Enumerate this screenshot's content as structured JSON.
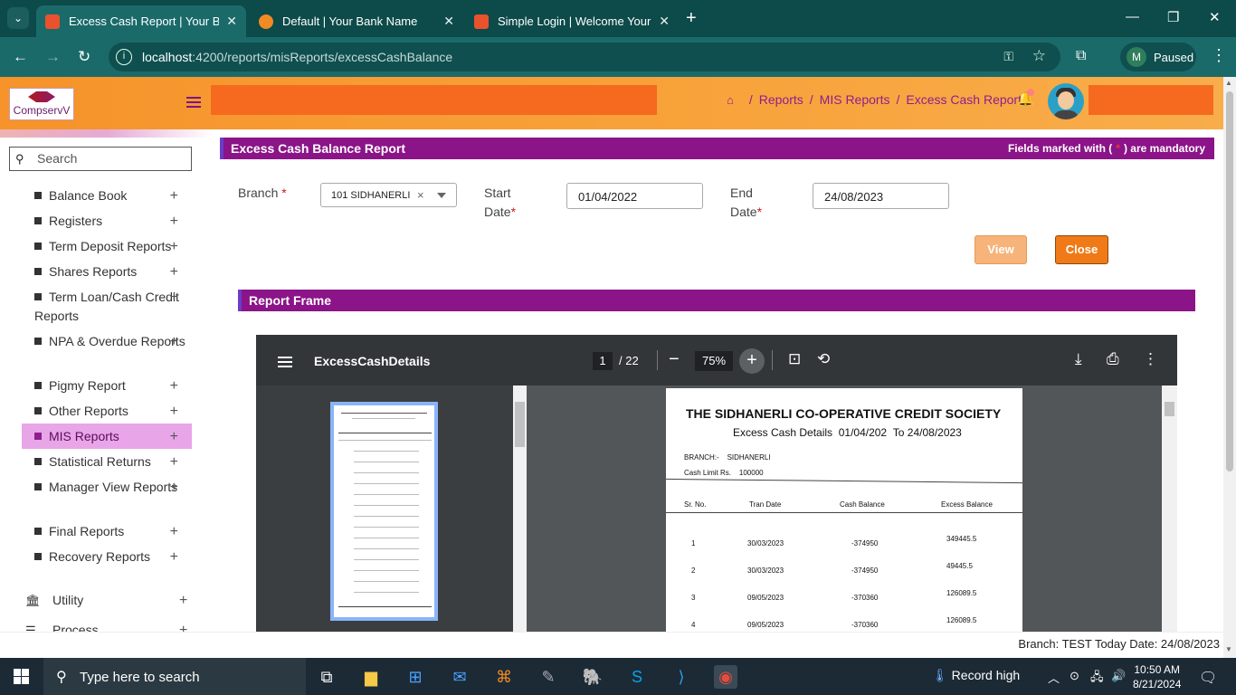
{
  "browser": {
    "tabs": [
      {
        "title": "Excess Cash Report | Your Bank",
        "active": true
      },
      {
        "title": "Default | Your Bank Name",
        "active": false
      },
      {
        "title": "Simple Login | Welcome Your B",
        "active": false
      }
    ],
    "url_host": "localhost",
    "url_path": ":4200/reports/misReports/excessCashBalance",
    "profile_initial": "M",
    "profile_status": "Paused"
  },
  "app": {
    "logo_text": "CompservV",
    "breadcrumbs": [
      "Reports",
      "MIS Reports",
      "Excess Cash Report"
    ]
  },
  "sidebar": {
    "search_placeholder": "Search",
    "items": [
      {
        "label": "Balance Book"
      },
      {
        "label": "Registers"
      },
      {
        "label": "Term Deposit Reports"
      },
      {
        "label": "Shares Reports"
      },
      {
        "label": "Term Loan/Cash Credit Reports"
      },
      {
        "label": "NPA & Overdue Reports"
      },
      {
        "label": "Pigmy Report"
      },
      {
        "label": "Other Reports"
      },
      {
        "label": "MIS Reports",
        "active": true
      },
      {
        "label": "Statistical Returns"
      },
      {
        "label": "Manager View Reports"
      },
      {
        "label": "Final Reports"
      },
      {
        "label": "Recovery Reports"
      }
    ],
    "top_items": [
      {
        "label": "Utility",
        "icon": "bank-icon"
      },
      {
        "label": "Process",
        "icon": "list-icon"
      }
    ]
  },
  "form": {
    "title": "Excess Cash Balance Report",
    "mandatory_note_prefix": "Fields marked with (",
    "mandatory_note_star": "*",
    "mandatory_note_suffix": ") are mandatory",
    "branch_label": "Branch",
    "branch_value": "101 SIDHANERLI",
    "start_label_1": "Start",
    "start_label_2": "Date",
    "start_value": "01/04/2022",
    "end_label_1": "End",
    "end_label_2": "Date",
    "end_value": "24/08/2023",
    "view_button": "View",
    "close_button": "Close",
    "report_frame_title": "Report Frame"
  },
  "pdf": {
    "doc_name": "ExcessCashDetails",
    "page": "1",
    "total_pages": "/ 22",
    "zoom": "75%",
    "society": "THE SIDHANERLI CO-OPERATIVE CREDIT SOCIETY",
    "subtitle_prefix": "Excess Cash Details",
    "subtitle_from": "01/04/202",
    "subtitle_to": "To 24/08/2023",
    "branch_label": "BRANCH:-",
    "branch_value": "SIDHANERLI",
    "cash_limit_label": "Cash Limit Rs.",
    "cash_limit_value": "100000",
    "columns": [
      "Sr. No.",
      "Tran Date",
      "Cash Balance",
      "Excess Balance"
    ],
    "rows": [
      {
        "sr": "1",
        "date": "30/03/2023",
        "cash": "-374950",
        "excess": "349445.5"
      },
      {
        "sr": "2",
        "date": "30/03/2023",
        "cash": "-374950",
        "excess": "49445.5"
      },
      {
        "sr": "3",
        "date": "09/05/2023",
        "cash": "-370360",
        "excess": "126089.5"
      },
      {
        "sr": "4",
        "date": "09/05/2023",
        "cash": "-370360",
        "excess": "126089.5"
      }
    ]
  },
  "status": {
    "text": "Branch: TEST Today Date: 24/08/2023"
  },
  "taskbar": {
    "search_placeholder": "Type here to search",
    "weather": "Record high",
    "time": "10:50 AM",
    "date": "8/21/2024"
  }
}
